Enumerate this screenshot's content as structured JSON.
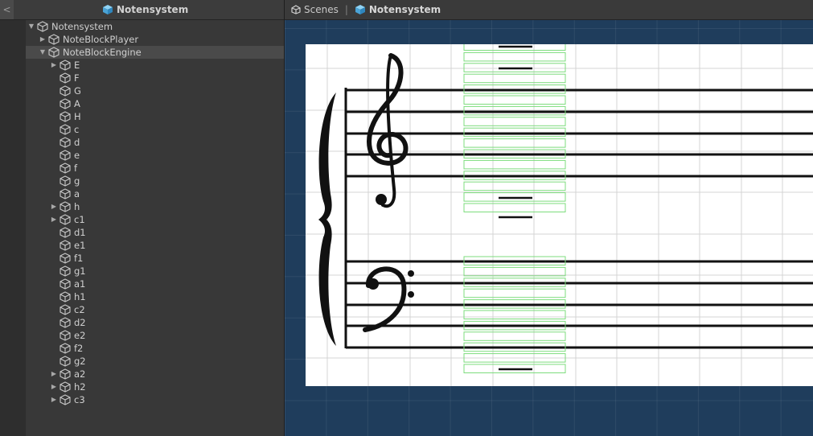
{
  "hierarchy": {
    "back_label": "<",
    "title": "Notensystem",
    "title_icon": "unity-prefab-icon",
    "rows": [
      {
        "label": "Notensystem",
        "depth": 0,
        "arrow": "expanded",
        "selected": false
      },
      {
        "label": "NoteBlockPlayer",
        "depth": 1,
        "arrow": "collapsed",
        "selected": false
      },
      {
        "label": "NoteBlockEngine",
        "depth": 1,
        "arrow": "expanded",
        "selected": true
      },
      {
        "label": "E",
        "depth": 2,
        "arrow": "collapsed",
        "selected": false
      },
      {
        "label": "F",
        "depth": 2,
        "arrow": "none",
        "selected": false
      },
      {
        "label": "G",
        "depth": 2,
        "arrow": "none",
        "selected": false
      },
      {
        "label": "A",
        "depth": 2,
        "arrow": "none",
        "selected": false
      },
      {
        "label": "H",
        "depth": 2,
        "arrow": "none",
        "selected": false
      },
      {
        "label": "c",
        "depth": 2,
        "arrow": "none",
        "selected": false
      },
      {
        "label": "d",
        "depth": 2,
        "arrow": "none",
        "selected": false
      },
      {
        "label": "e",
        "depth": 2,
        "arrow": "none",
        "selected": false
      },
      {
        "label": "f",
        "depth": 2,
        "arrow": "none",
        "selected": false
      },
      {
        "label": "g",
        "depth": 2,
        "arrow": "none",
        "selected": false
      },
      {
        "label": "a",
        "depth": 2,
        "arrow": "none",
        "selected": false
      },
      {
        "label": "h",
        "depth": 2,
        "arrow": "collapsed",
        "selected": false
      },
      {
        "label": "c1",
        "depth": 2,
        "arrow": "collapsed",
        "selected": false
      },
      {
        "label": "d1",
        "depth": 2,
        "arrow": "none",
        "selected": false
      },
      {
        "label": "e1",
        "depth": 2,
        "arrow": "none",
        "selected": false
      },
      {
        "label": "f1",
        "depth": 2,
        "arrow": "none",
        "selected": false
      },
      {
        "label": "g1",
        "depth": 2,
        "arrow": "none",
        "selected": false
      },
      {
        "label": "a1",
        "depth": 2,
        "arrow": "none",
        "selected": false
      },
      {
        "label": "h1",
        "depth": 2,
        "arrow": "none",
        "selected": false
      },
      {
        "label": "c2",
        "depth": 2,
        "arrow": "none",
        "selected": false
      },
      {
        "label": "d2",
        "depth": 2,
        "arrow": "none",
        "selected": false
      },
      {
        "label": "e2",
        "depth": 2,
        "arrow": "none",
        "selected": false
      },
      {
        "label": "f2",
        "depth": 2,
        "arrow": "none",
        "selected": false
      },
      {
        "label": "g2",
        "depth": 2,
        "arrow": "none",
        "selected": false
      },
      {
        "label": "a2",
        "depth": 2,
        "arrow": "collapsed",
        "selected": false
      },
      {
        "label": "h2",
        "depth": 2,
        "arrow": "collapsed",
        "selected": false
      },
      {
        "label": "c3",
        "depth": 2,
        "arrow": "collapsed",
        "selected": false
      }
    ]
  },
  "scene": {
    "breadcrumb_root": "Scenes",
    "breadcrumb_root_icon": "unity-logo-icon",
    "breadcrumb_separator": "|",
    "breadcrumb_current": "Notensystem",
    "breadcrumb_current_icon": "unity-prefab-icon"
  },
  "colors": {
    "panel_bg": "#383838",
    "selection": "#4a4a4a",
    "scene_bg": "#1f3d5c",
    "icon_blue": "#5ab4e6",
    "collider_green": "#7ddc7d"
  }
}
